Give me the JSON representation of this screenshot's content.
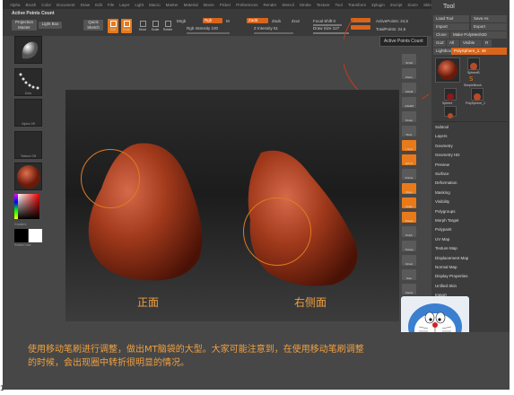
{
  "menubar": {
    "items": [
      "Alpha",
      "Brush",
      "Color",
      "Document",
      "Draw",
      "Edit",
      "File",
      "Layer",
      "Light",
      "Macro",
      "Marker",
      "Material",
      "Movie",
      "Picker",
      "Preferences",
      "Render",
      "Stencil",
      "Stroke",
      "Texture",
      "Tool",
      "Transform",
      "Zplugin",
      "Zscript",
      "Zoom",
      "Skins",
      "Script"
    ]
  },
  "toolbar": {
    "title": "Active Points Count",
    "projection_master": "Projection\nMaster",
    "lightbox": "Light Box",
    "quick_sketch": "Quick\nSketch",
    "icons": [
      "Edit",
      "Draw",
      "Move",
      "Scale",
      "Rotate"
    ],
    "mrgb": "Mrgb",
    "rgb": "Rgb",
    "m": "M",
    "zadd": "Zadd",
    "zsub": "Zsub",
    "zcut": "Zcut",
    "focal_shift": "Focal Shift",
    "focal_shift_value": "0",
    "active_points": "ActivePoints: 24,5",
    "total_points": "TotalPoints: 24,5",
    "rgb_intensity": "Rgb Intensity 100",
    "z_intensity": "Z Intensity 51",
    "draw_size": "Draw Size 127"
  },
  "tooltip": "Active Points Count",
  "left_tray": {
    "labels": [
      "",
      "Dots",
      "Alpha Off",
      "Texture Off",
      "",
      "Gradient",
      "SwitchColor"
    ]
  },
  "canvas": {
    "caption_left": "正面",
    "caption_right": "右侧面"
  },
  "right_shelf": {
    "buttons": [
      "Scroll",
      "Zoom",
      "Actual",
      "AAHalf",
      "Persp",
      "Floor",
      "L.Sym",
      "QXYZ",
      "Frame",
      "Move",
      "Scale",
      "Rotate",
      "PolyF",
      "Transp",
      "Ghost",
      "Solo",
      "Xpose"
    ]
  },
  "tool_panel": {
    "title": "Tool",
    "buttons": {
      "load": "Load Tool",
      "save": "Save As",
      "import": "Import",
      "export": "Export",
      "clone": "Clone",
      "make_poly": "Make PolyMesh3D",
      "goz": "GoZ",
      "all": "All",
      "visible": "Visible",
      "r": "R",
      "lightbox_tools": "Lightbox▸Tools",
      "polysphere": "PolySphere_1. 48"
    },
    "tool_labels": [
      "SphereB",
      "PolyMesh",
      "Sphere",
      "PolySphere_1",
      "SimpleBrush"
    ],
    "menu": [
      "Subtool",
      "Layers",
      "Geometry",
      "Geometry HD",
      "Preview",
      "Surface",
      "Deformation",
      "Masking",
      "Visibility",
      "Polygroups",
      "Morph Target",
      "Polypaint",
      "UV Map",
      "Texture Map",
      "Displacement Map",
      "Normal Map",
      "Display Properties",
      "Unified Skin",
      "Import",
      "Export"
    ]
  },
  "bottom": {
    "line1": "使用移动笔刷进行调整，做出MT脑袋的大型。大家可能注意到，在使用移动笔刷调整",
    "line2": "的时候，会出现圈中转折很明显的情况。"
  },
  "corner_mark": "1",
  "colors": {
    "accent_orange": "#e87a1a",
    "caption_orange": "#f0a040",
    "blob_red": "#a8401e",
    "background": "#474747"
  }
}
